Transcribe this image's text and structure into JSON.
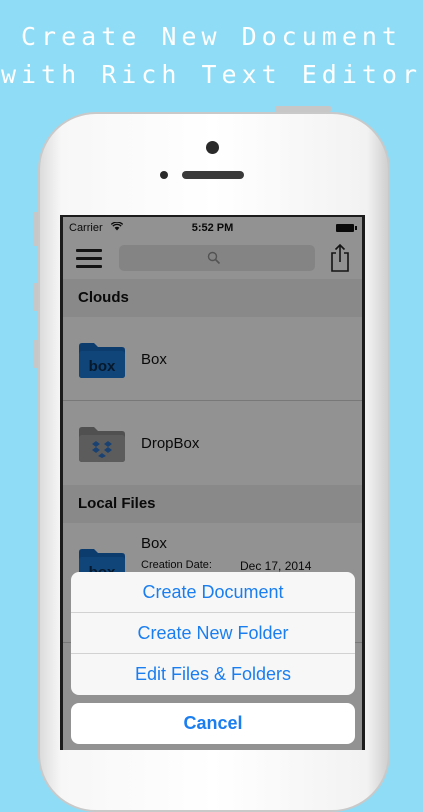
{
  "promo": {
    "headline_line1": "Create New Document",
    "headline_line2": "with Rich Text Editor"
  },
  "statusbar": {
    "carrier": "Carrier",
    "time": "5:52 PM"
  },
  "navbar": {
    "menu_icon": "hamburger-menu-icon",
    "search_icon": "search-icon",
    "share_icon": "share-icon"
  },
  "sections": [
    {
      "title": "Clouds",
      "items": [
        {
          "label": "Box",
          "icon": "box-folder-icon"
        },
        {
          "label": "DropBox",
          "icon": "dropbox-folder-icon"
        }
      ]
    },
    {
      "title": "Local Files",
      "items": [
        {
          "label": "Box",
          "icon": "box-folder-icon",
          "creation_date_label": "Creation Date:",
          "creation_date": "Dec 17, 2014"
        }
      ]
    }
  ],
  "action_sheet": {
    "items": [
      "Create Document",
      "Create New Folder",
      "Edit Files & Folders"
    ],
    "cancel": "Cancel"
  },
  "colors": {
    "background": "#8fdcf6",
    "accent": "#1a7ef0",
    "box_blue": "#1a73c8",
    "dropbox_gray": "#9a9a9a"
  }
}
